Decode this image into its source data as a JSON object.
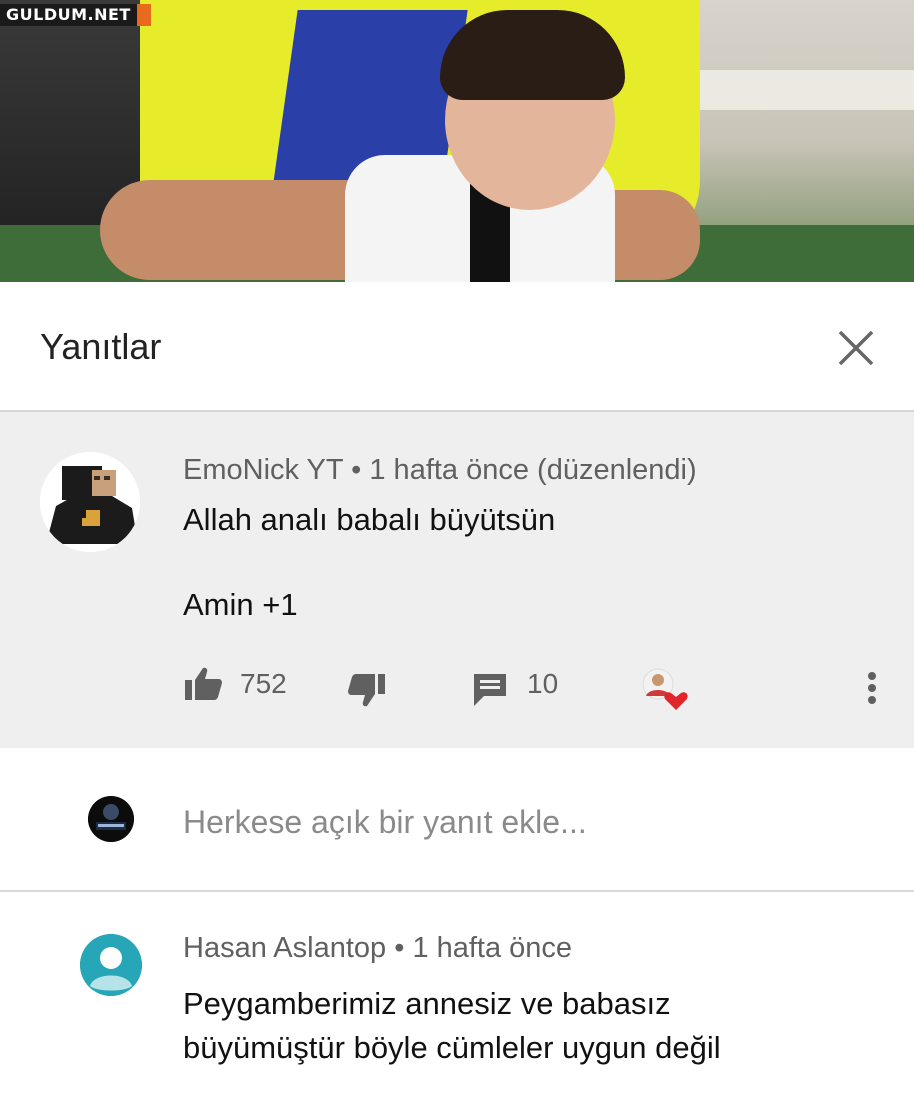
{
  "watermark": {
    "text": "GULDUM.NET"
  },
  "panel": {
    "title": "Yanıtlar",
    "close_icon": "close-icon"
  },
  "comment": {
    "author": "EmoNick YT",
    "time": "1 hafta önce (düzenlendi)",
    "text_line1": "Allah analı babalı büyütsün",
    "text_line2": "Amin +1",
    "likes": "752",
    "replies": "10"
  },
  "reply_input": {
    "placeholder": "Herkese açık bir yanıt ekle..."
  },
  "comment2": {
    "author": "Hasan Aslantop",
    "time": "1 hafta önce",
    "text_line1": "Peygamberimiz annesiz ve babasız",
    "text_line2": "büyümüştür böyle cümleler uygun değil"
  },
  "colors": {
    "heart": "#e0262b",
    "meta_gray": "#606060",
    "avatar_teal": "#26a6b6"
  }
}
